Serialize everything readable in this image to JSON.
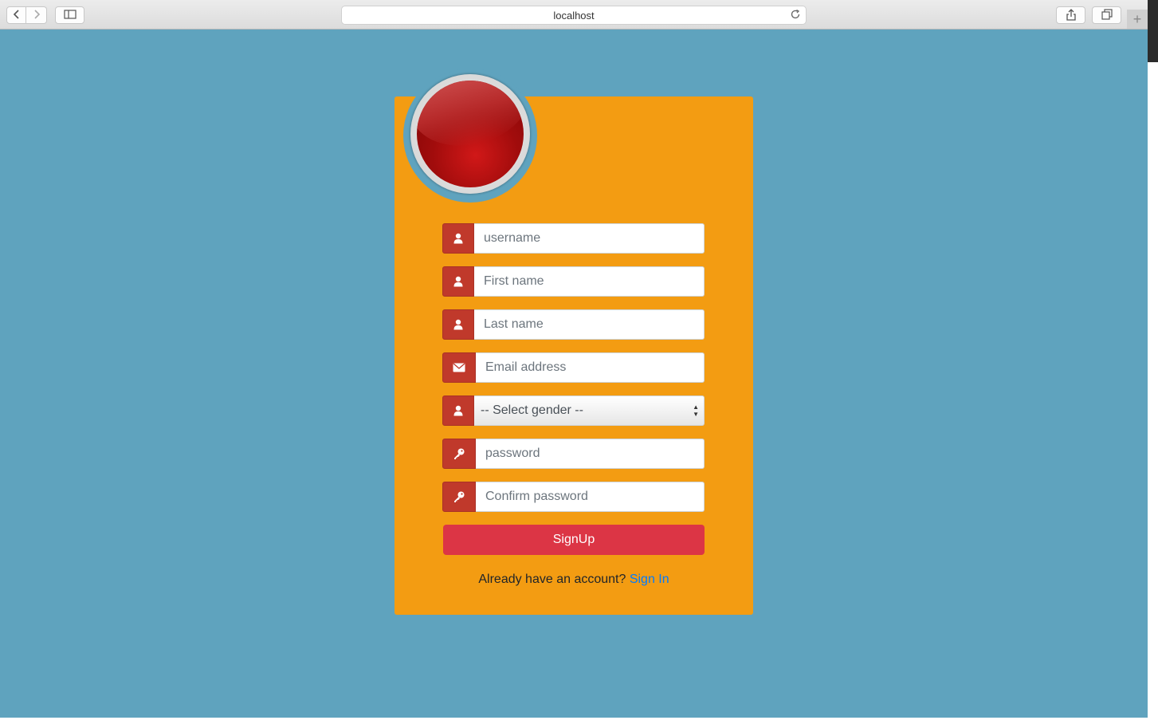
{
  "browser": {
    "url": "localhost",
    "icons": {
      "back": "chevron-left-icon",
      "forward": "chevron-right-icon",
      "sidebar": "sidebar-icon",
      "reload": "reload-icon",
      "share": "share-icon",
      "tabs": "tabs-overview-icon",
      "new_tab": "plus-icon"
    }
  },
  "colors": {
    "page_background": "#5fa3be",
    "card_background": "#f39c12",
    "addon_background": "#c0392b",
    "button_background": "#dc3545",
    "link": "#007bff"
  },
  "form": {
    "username_placeholder": "username",
    "first_name_placeholder": "First name",
    "last_name_placeholder": "Last name",
    "email_placeholder": "Email address",
    "gender_selected": "-- Select gender --",
    "password_placeholder": "password",
    "confirm_password_placeholder": "Confirm password",
    "submit_label": "SignUp",
    "signin_prompt": "Already have an account?",
    "signin_link": "Sign In"
  }
}
